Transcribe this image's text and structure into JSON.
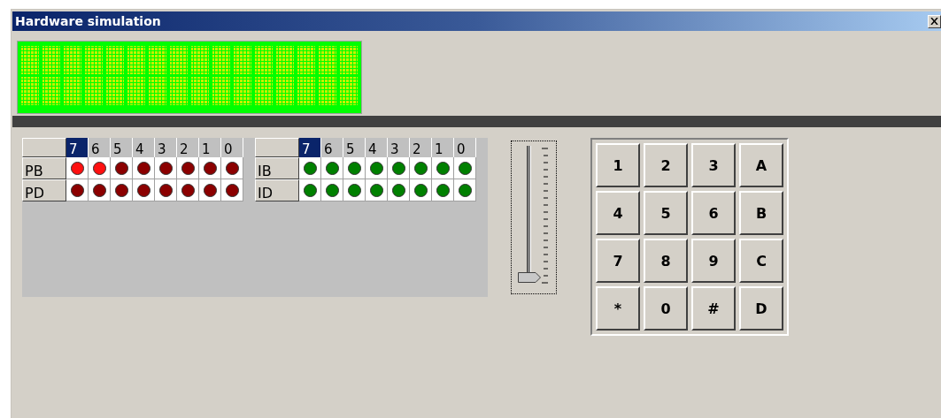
{
  "window": {
    "title": "Hardware simulation"
  },
  "ports": [
    {
      "kind": "output",
      "columns": [
        {
          "label": "7",
          "selected": true
        },
        {
          "label": "6",
          "selected": false
        },
        {
          "label": "5",
          "selected": false
        },
        {
          "label": "4",
          "selected": false
        },
        {
          "label": "3",
          "selected": false
        },
        {
          "label": "2",
          "selected": false
        },
        {
          "label": "1",
          "selected": false
        },
        {
          "label": "0",
          "selected": false
        }
      ],
      "rows": [
        {
          "label": "PB",
          "leds": [
            {
              "on": true
            },
            {
              "on": true
            },
            {
              "on": false
            },
            {
              "on": false
            },
            {
              "on": false
            },
            {
              "on": false
            },
            {
              "on": false
            },
            {
              "on": false
            }
          ]
        },
        {
          "label": "PD",
          "leds": [
            {
              "on": false
            },
            {
              "on": false
            },
            {
              "on": false
            },
            {
              "on": false
            },
            {
              "on": false
            },
            {
              "on": false
            },
            {
              "on": false
            },
            {
              "on": false
            }
          ]
        }
      ]
    },
    {
      "kind": "input",
      "columns": [
        {
          "label": "7",
          "selected": true
        },
        {
          "label": "6",
          "selected": false
        },
        {
          "label": "5",
          "selected": false
        },
        {
          "label": "4",
          "selected": false
        },
        {
          "label": "3",
          "selected": false
        },
        {
          "label": "2",
          "selected": false
        },
        {
          "label": "1",
          "selected": false
        },
        {
          "label": "0",
          "selected": false
        }
      ],
      "rows": [
        {
          "label": "IB",
          "leds": [
            {
              "on": false
            },
            {
              "on": false
            },
            {
              "on": false
            },
            {
              "on": false
            },
            {
              "on": false
            },
            {
              "on": false
            },
            {
              "on": false
            },
            {
              "on": false
            }
          ]
        },
        {
          "label": "ID",
          "leds": [
            {
              "on": false
            },
            {
              "on": false
            },
            {
              "on": false
            },
            {
              "on": false
            },
            {
              "on": false
            },
            {
              "on": false
            },
            {
              "on": false
            },
            {
              "on": false
            }
          ]
        }
      ]
    }
  ],
  "slider": {
    "level": 0
  },
  "keypad": {
    "keys": [
      "1",
      "2",
      "3",
      "A",
      "4",
      "5",
      "6",
      "B",
      "7",
      "8",
      "9",
      "C",
      "*",
      "0",
      "#",
      "D"
    ]
  }
}
